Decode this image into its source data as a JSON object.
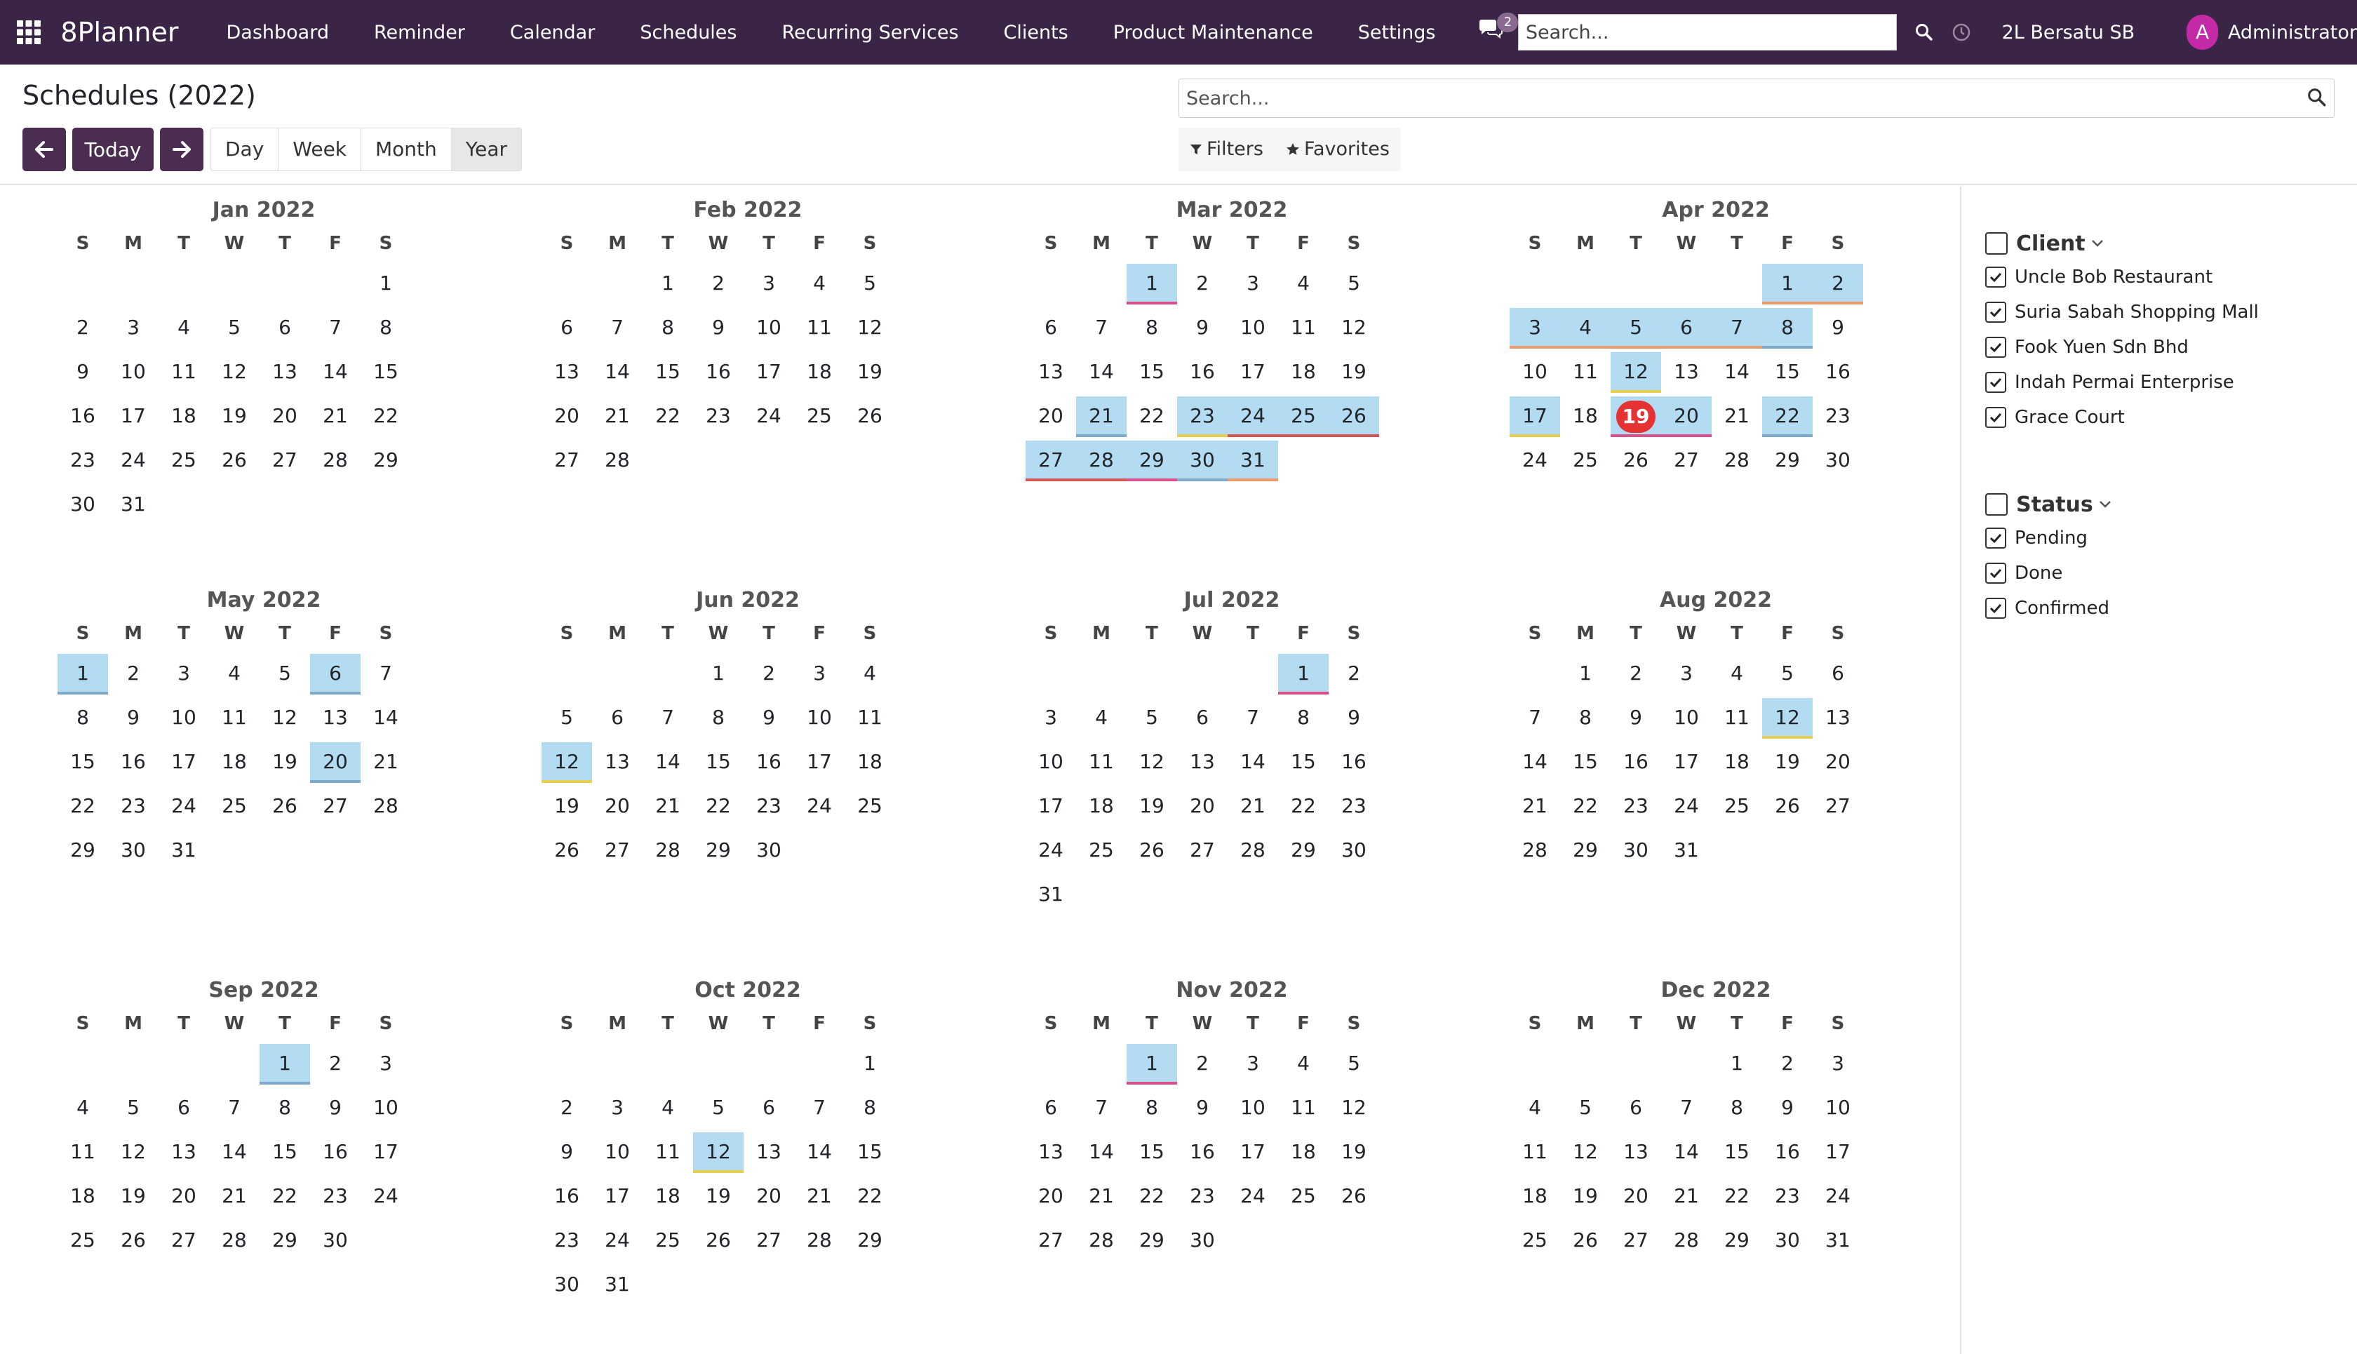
{
  "nav": {
    "brand": "8Planner",
    "menu": [
      "Dashboard",
      "Reminder",
      "Calendar",
      "Schedules",
      "Recurring Services",
      "Clients",
      "Product Maintenance",
      "Settings"
    ],
    "chat_count": "2",
    "search_placeholder": "Search...",
    "company": "2L Bersatu SB",
    "avatar_letter": "A",
    "user": "Administrator"
  },
  "control": {
    "title": "Schedules (2022)",
    "today_label": "Today",
    "scales": [
      "Day",
      "Week",
      "Month",
      "Year"
    ],
    "active_scale": "Year",
    "search_placeholder": "Search...",
    "filters_label": "Filters",
    "favorites_label": "Favorites"
  },
  "calendar": {
    "weekday_labels": [
      "S",
      "M",
      "T",
      "W",
      "T",
      "F",
      "S"
    ],
    "today": {
      "month": 4,
      "day": 19
    },
    "months": [
      {
        "title": "Jan 2022",
        "start": 6,
        "days": 31,
        "events": []
      },
      {
        "title": "Feb 2022",
        "start": 2,
        "days": 28,
        "events": []
      },
      {
        "title": "Mar 2022",
        "start": 2,
        "days": 31,
        "events": [
          [
            1,
            "pink"
          ],
          [
            21,
            "blue"
          ],
          [
            23,
            "yellow"
          ],
          [
            24,
            "red"
          ],
          [
            25,
            "red"
          ],
          [
            26,
            "red"
          ],
          [
            27,
            "red"
          ],
          [
            28,
            "red"
          ],
          [
            29,
            "pink"
          ],
          [
            30,
            "blue"
          ],
          [
            31,
            "orange"
          ]
        ]
      },
      {
        "title": "Apr 2022",
        "start": 5,
        "days": 30,
        "events": [
          [
            1,
            "orange"
          ],
          [
            2,
            "orange"
          ],
          [
            3,
            "orange"
          ],
          [
            4,
            "orange"
          ],
          [
            5,
            "orange"
          ],
          [
            6,
            "orange"
          ],
          [
            7,
            "orange"
          ],
          [
            8,
            "blue"
          ],
          [
            12,
            "yellow"
          ],
          [
            17,
            "yellow"
          ],
          [
            19,
            "pink"
          ],
          [
            20,
            "pink"
          ],
          [
            22,
            "blue"
          ]
        ]
      },
      {
        "title": "May 2022",
        "start": 0,
        "days": 31,
        "events": [
          [
            1,
            "blue"
          ],
          [
            6,
            "blue"
          ],
          [
            20,
            "blue"
          ]
        ]
      },
      {
        "title": "Jun 2022",
        "start": 3,
        "days": 30,
        "events": [
          [
            12,
            "yellow"
          ]
        ]
      },
      {
        "title": "Jul 2022",
        "start": 5,
        "days": 31,
        "events": [
          [
            1,
            "pink"
          ]
        ]
      },
      {
        "title": "Aug 2022",
        "start": 1,
        "days": 31,
        "events": [
          [
            12,
            "yellow"
          ]
        ]
      },
      {
        "title": "Sep 2022",
        "start": 4,
        "days": 30,
        "events": [
          [
            1,
            "blue"
          ]
        ]
      },
      {
        "title": "Oct 2022",
        "start": 6,
        "days": 31,
        "events": [
          [
            12,
            "yellow"
          ]
        ]
      },
      {
        "title": "Nov 2022",
        "start": 2,
        "days": 30,
        "events": [
          [
            1,
            "pink"
          ]
        ]
      },
      {
        "title": "Dec 2022",
        "start": 4,
        "days": 31,
        "events": []
      }
    ]
  },
  "sidebar": {
    "client_title": "Client",
    "clients": [
      "Uncle Bob Restaurant",
      "Suria Sabah Shopping Mall",
      "Fook Yuen Sdn Bhd",
      "Indah Permai Enterprise",
      "Grace Court"
    ],
    "status_title": "Status",
    "statuses": [
      "Pending",
      "Done",
      "Confirmed"
    ]
  },
  "colors": {
    "nav_bg": "#3b2546",
    "event_bg": "#b3dcf2",
    "today": "#e53333",
    "primary_btn": "#4b2d51",
    "avatar": "#c42aa7"
  }
}
